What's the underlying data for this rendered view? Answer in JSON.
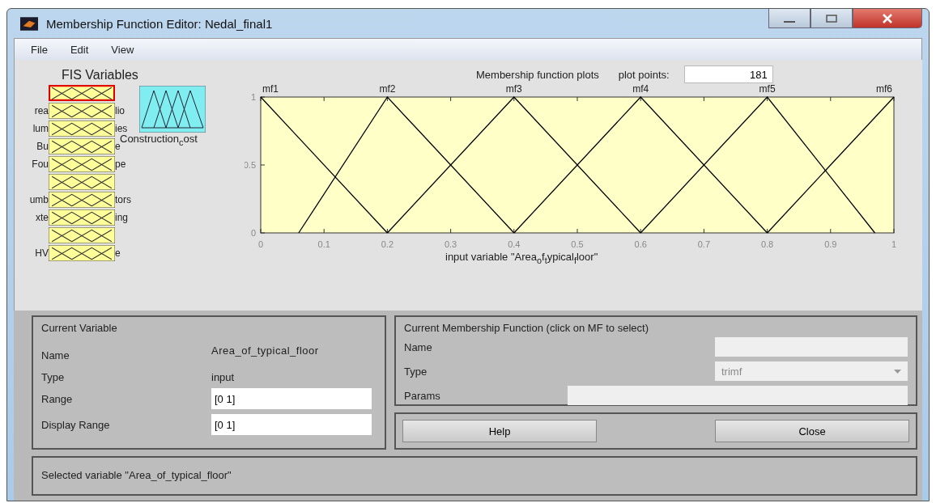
{
  "window": {
    "title": "Membership Function Editor: Nedal_final1"
  },
  "menu": [
    "File",
    "Edit",
    "View"
  ],
  "fis_variables": {
    "title": "FIS Variables",
    "inputs": [
      {
        "selected": true
      },
      {
        "left": "rea",
        "right": "lio",
        "selected": false
      },
      {
        "left": "lum",
        "right": "ies",
        "selected": false
      },
      {
        "left": "Bu",
        "right": "e",
        "selected": false
      },
      {
        "left": "Fou",
        "right": "pe",
        "selected": false
      },
      {
        "selected": false
      },
      {
        "left": "umb",
        "right": "tors",
        "selected": false
      },
      {
        "left": "xte",
        "right": "ing",
        "selected": false
      },
      {
        "selected": false
      },
      {
        "left": "HV",
        "right": "e",
        "selected": false
      }
    ],
    "output": {
      "label": "Construction$_{c}$ost",
      "selected": false
    }
  },
  "plot": {
    "title": "Membership function plots",
    "plot_points_label": "plot points:",
    "plot_points": "181",
    "chart_data": {
      "type": "line",
      "xlabel": "input variable \"Area$_{o}$f$_{t}$ypical$_{f}$loor\"",
      "x": [
        0,
        0.06,
        0.2,
        0.4,
        0.6,
        0.8,
        0.97,
        1
      ],
      "series": [
        {
          "name": "mf1",
          "color": "#000000",
          "values": [
            1,
            0.7,
            0,
            null,
            null,
            null,
            null,
            null
          ]
        },
        {
          "name": "mf2",
          "color": "#000000",
          "values": [
            null,
            0,
            1,
            0,
            null,
            null,
            null,
            null
          ]
        },
        {
          "name": "mf3",
          "color": "#000000",
          "values": [
            null,
            null,
            0,
            1,
            0,
            null,
            null,
            null
          ]
        },
        {
          "name": "mf4",
          "color": "#000000",
          "values": [
            null,
            null,
            null,
            0,
            1,
            0,
            null,
            null
          ]
        },
        {
          "name": "mf5",
          "color": "#000000",
          "values": [
            null,
            null,
            null,
            null,
            0,
            1,
            0,
            null
          ]
        },
        {
          "name": "mf6",
          "color": "#000000",
          "values": [
            null,
            null,
            null,
            null,
            null,
            0,
            0.85,
            1
          ]
        }
      ],
      "xlim": [
        0,
        1
      ],
      "ylim": [
        0,
        1
      ],
      "xticks": [
        0,
        0.1,
        0.2,
        0.3,
        0.4,
        0.5,
        0.6,
        0.7,
        0.8,
        0.9,
        1
      ],
      "yticks": [
        0,
        0.5,
        1
      ]
    }
  },
  "current_variable": {
    "title": "Current Variable",
    "name_label": "Name",
    "name": "Area_of_typical_floor",
    "type_label": "Type",
    "type": "input",
    "range_label": "Range",
    "range": "[0 1]",
    "display_range_label": "Display Range",
    "display_range": "[0 1]"
  },
  "current_mf": {
    "title": "Current Membership Function (click on MF to select)",
    "name_label": "Name",
    "type_label": "Type",
    "type": "trimf",
    "type_disabled": true,
    "params_label": "Params"
  },
  "buttons": [
    "Help",
    "Close"
  ],
  "status": "Selected variable \"Area_of_typical_floor\""
}
